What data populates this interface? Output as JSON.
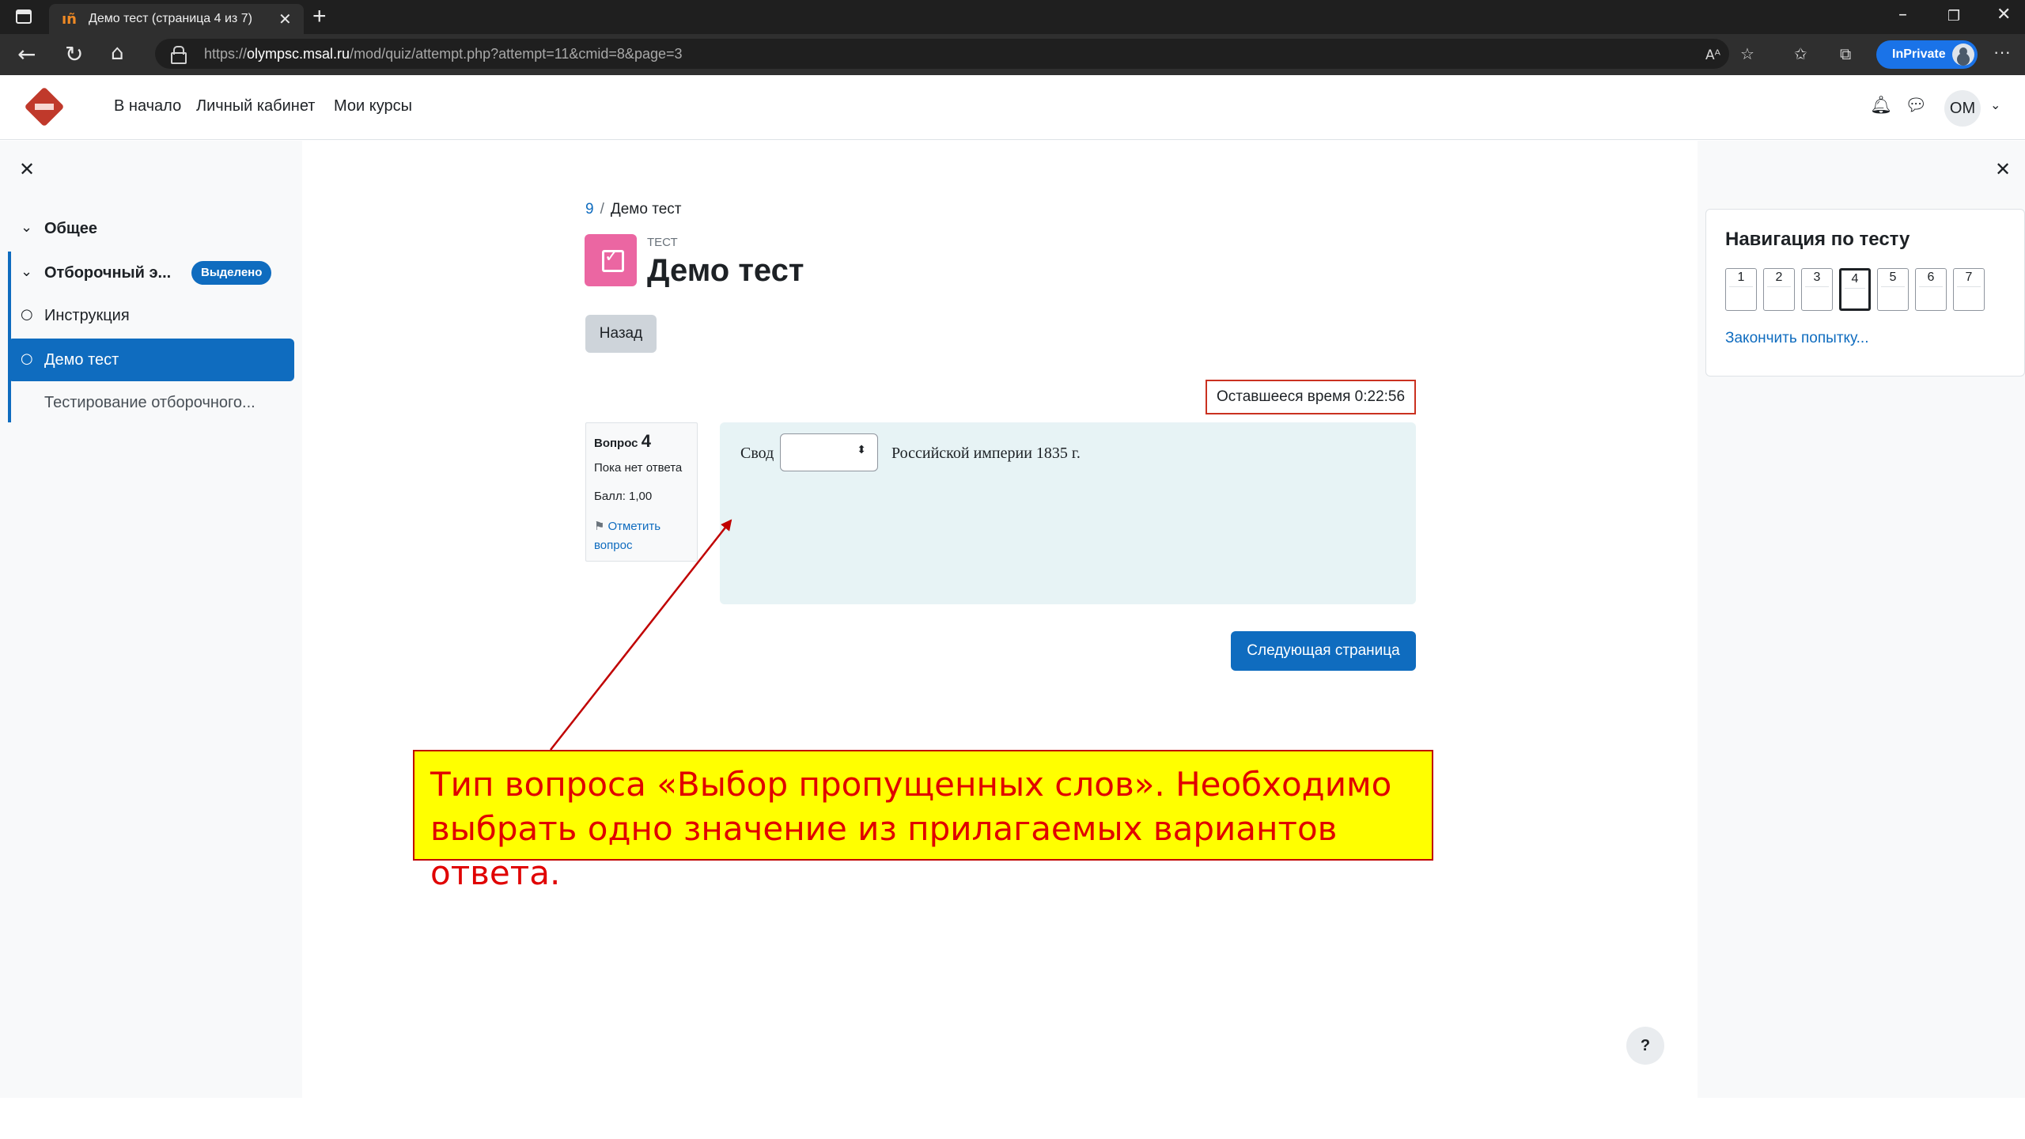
{
  "browser": {
    "tab_title": "Демо тест (страница 4 из 7)",
    "tab_favicon": "ıñ",
    "url_prefix": "https://",
    "url_host": "olympsc.msal.ru",
    "url_path": "/mod/quiz/attempt.php?attempt=11&cmid=8&page=3",
    "inprivate_label": "InPrivate"
  },
  "topnav": {
    "links": [
      "В начало",
      "Личный кабинет",
      "Мои курсы"
    ],
    "user_initials": "ОМ"
  },
  "course_index": {
    "items": [
      {
        "label": "Общее",
        "icon": "chevron-down-icon"
      },
      {
        "label": "Отборочный э...",
        "icon": "chevron-down-icon",
        "badge": "Выделено"
      },
      {
        "label": "Инструкция",
        "icon": "circle-icon"
      },
      {
        "label": "Демо тест",
        "icon": "circle-icon",
        "active": true
      },
      {
        "label": "Тестирование отборочного..."
      }
    ]
  },
  "main": {
    "breadcrumb": [
      "9",
      "Демо тест"
    ],
    "kicker": "ТЕСТ",
    "title": "Демо тест",
    "back_label": "Назад",
    "timer": "Оставшееся время 0:22:56",
    "question": {
      "label": "Вопрос",
      "number": "4",
      "state": "Пока нет ответа",
      "grade": "Балл: 1,00",
      "flag_label": "Отметить вопрос",
      "text_before": "Свод",
      "select_value": "",
      "text_after": "Российской империи 1835 г."
    },
    "next_label": "Следующая страница",
    "help_label": "?"
  },
  "quiz_nav": {
    "title": "Навигация по тесту",
    "questions": [
      "1",
      "2",
      "3",
      "4",
      "5",
      "6",
      "7"
    ],
    "current": "4",
    "finish_label": "Закончить попытку..."
  },
  "annotation": {
    "text": "Тип вопроса «Выбор пропущенных слов». Необходимо выбрать одно значение из прилагаемых вариантов ответа.",
    "color": "#e00000",
    "background": "#ffff00"
  }
}
